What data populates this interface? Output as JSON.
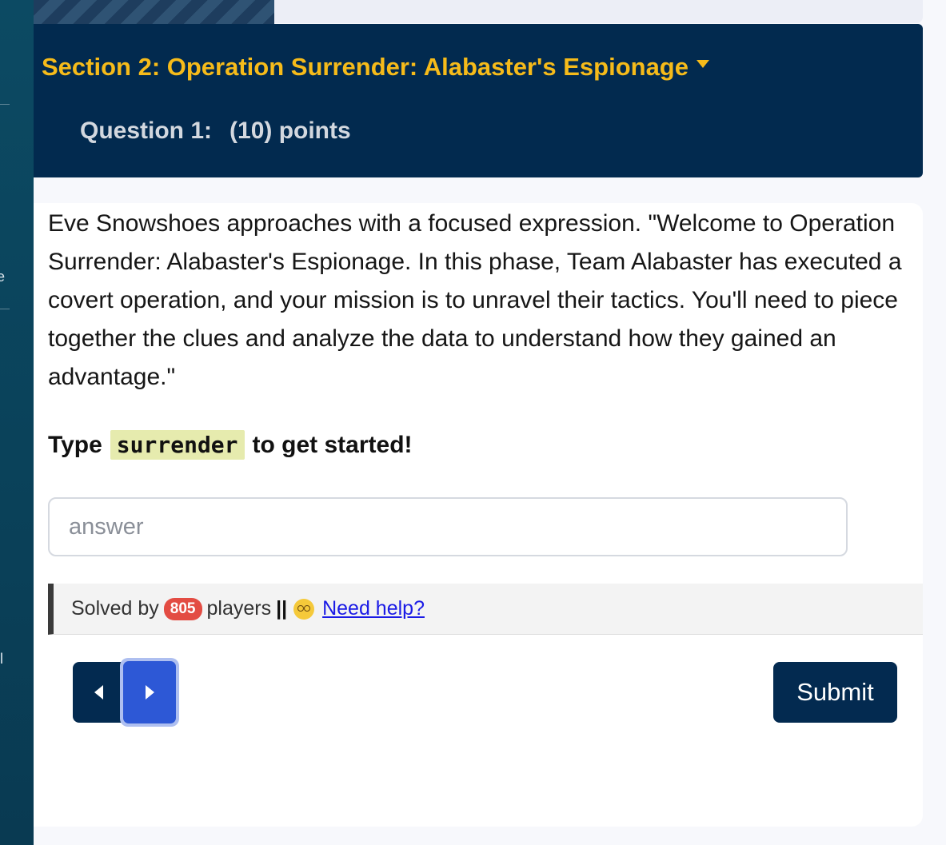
{
  "sidebar": {
    "edge_chars": [
      "e",
      "ll"
    ]
  },
  "header": {
    "section_title": "Section 2: Operation Surrender: Alabaster's Espionage",
    "question_label": "Question 1:",
    "points_label": "(10) points"
  },
  "question": {
    "description": "Eve Snowshoes approaches with a focused expression. \"Welcome to Operation Surrender: Alabaster's Espionage. In this phase, Team Alabaster has executed a covert operation, and your mission is to unravel their tactics. You'll need to piece together the clues and analyze the data to understand how they gained an advantage.\"",
    "prompt_before": "Type",
    "prompt_code": "surrender",
    "prompt_after": "to get started!"
  },
  "answer": {
    "placeholder": "answer",
    "value": ""
  },
  "status": {
    "solved_prefix": "Solved by",
    "solved_count": "805",
    "solved_suffix": "players",
    "separator": "||",
    "help_icon": "woozy-face-icon",
    "help_label": "Need help?"
  },
  "nav": {
    "prev_icon": "caret-left-icon",
    "next_icon": "caret-right-icon",
    "submit_label": "Submit"
  },
  "colors": {
    "header_bg": "#022a4f",
    "section_title": "#f6bb1a",
    "badge": "#e34c43",
    "next_button": "#2d58d6",
    "submit_bg": "#032a50"
  }
}
